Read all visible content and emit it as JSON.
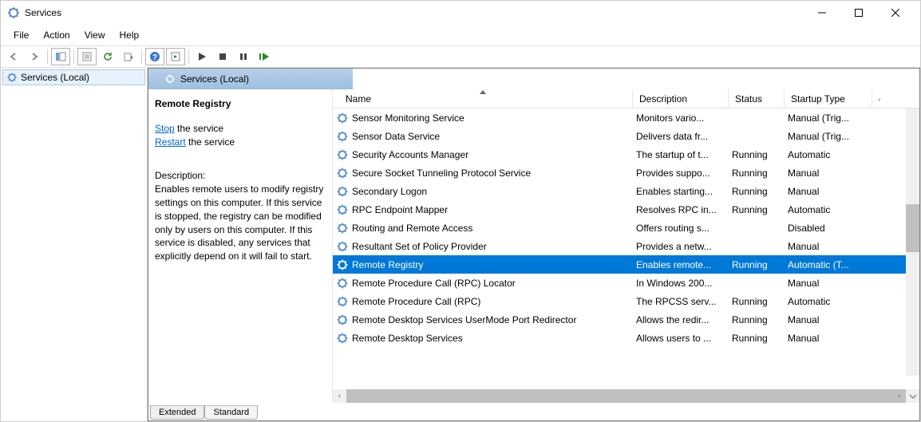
{
  "window": {
    "title": "Services"
  },
  "menu": {
    "file": "File",
    "action": "Action",
    "view": "View",
    "help": "Help"
  },
  "tree": {
    "root": "Services (Local)"
  },
  "header": {
    "label": "Services (Local)"
  },
  "detail": {
    "title": "Remote Registry",
    "stop_link": "Stop",
    "stop_suffix": " the service",
    "restart_link": "Restart",
    "restart_suffix": " the service",
    "desc_label": "Description:",
    "desc": "Enables remote users to modify registry settings on this computer. If this service is stopped, the registry can be modified only by users on this computer. If this service is disabled, any services that explicitly depend on it will fail to start."
  },
  "columns": {
    "name": "Name",
    "description": "Description",
    "status": "Status",
    "startup": "Startup Type"
  },
  "services": [
    {
      "name": "Remote Desktop Services",
      "desc": "Allows users to ...",
      "status": "Running",
      "startup": "Manual",
      "selected": false
    },
    {
      "name": "Remote Desktop Services UserMode Port Redirector",
      "desc": "Allows the redir...",
      "status": "Running",
      "startup": "Manual",
      "selected": false
    },
    {
      "name": "Remote Procedure Call (RPC)",
      "desc": "The RPCSS serv...",
      "status": "Running",
      "startup": "Automatic",
      "selected": false
    },
    {
      "name": "Remote Procedure Call (RPC) Locator",
      "desc": "In Windows 200...",
      "status": "",
      "startup": "Manual",
      "selected": false
    },
    {
      "name": "Remote Registry",
      "desc": "Enables remote...",
      "status": "Running",
      "startup": "Automatic (T...",
      "selected": true
    },
    {
      "name": "Resultant Set of Policy Provider",
      "desc": "Provides a netw...",
      "status": "",
      "startup": "Manual",
      "selected": false
    },
    {
      "name": "Routing and Remote Access",
      "desc": "Offers routing s...",
      "status": "",
      "startup": "Disabled",
      "selected": false
    },
    {
      "name": "RPC Endpoint Mapper",
      "desc": "Resolves RPC in...",
      "status": "Running",
      "startup": "Automatic",
      "selected": false
    },
    {
      "name": "Secondary Logon",
      "desc": "Enables starting...",
      "status": "Running",
      "startup": "Manual",
      "selected": false
    },
    {
      "name": "Secure Socket Tunneling Protocol Service",
      "desc": "Provides suppo...",
      "status": "Running",
      "startup": "Manual",
      "selected": false
    },
    {
      "name": "Security Accounts Manager",
      "desc": "The startup of t...",
      "status": "Running",
      "startup": "Automatic",
      "selected": false
    },
    {
      "name": "Sensor Data Service",
      "desc": "Delivers data fr...",
      "status": "",
      "startup": "Manual (Trig...",
      "selected": false
    },
    {
      "name": "Sensor Monitoring Service",
      "desc": "Monitors vario...",
      "status": "",
      "startup": "Manual (Trig...",
      "selected": false
    }
  ],
  "tabs": {
    "extended": "Extended",
    "standard": "Standard"
  }
}
